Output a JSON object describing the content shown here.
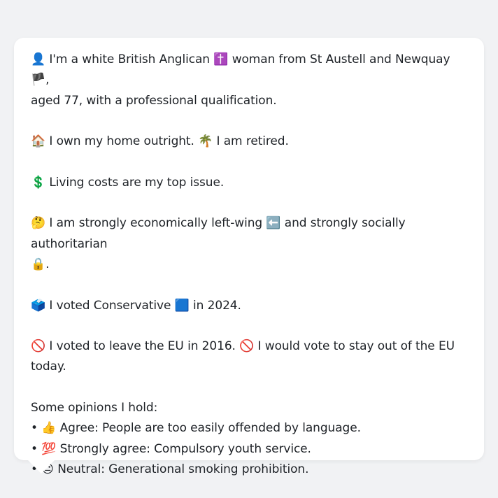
{
  "persona": {
    "intro_icon": "👤",
    "intro_a": "I'm a white British Anglican",
    "intro_cross": "✝️",
    "intro_b": "woman from St Austell and Newquay",
    "intro_flag": "🏴",
    "intro_c": ",",
    "intro_d": "aged 77, with a professional qualification.",
    "home_icon": "🏠",
    "home_text": "I own my home outright.",
    "retired_icon": "🌴",
    "retired_text": "I am retired.",
    "issue_icon": "💲",
    "issue_text": "Living costs are my top issue.",
    "ideology_icon": "🤔",
    "ideology_a": "I am strongly economically left-wing",
    "ideology_left_icon": "⬅️",
    "ideology_b": "and strongly socially authoritarian",
    "ideology_lock_icon": "🔒",
    "ideology_end": ".",
    "vote_icon": "🗳️",
    "vote_a": "I voted Conservative",
    "vote_party_icon": "🟦",
    "vote_b": "in 2024.",
    "eu_icon": "🚫",
    "eu_a": "I voted to leave the EU in 2016.",
    "eu_icon2": "🚫",
    "eu_b": "I would vote to stay out of the EU",
    "eu_c": "today.",
    "opinions_heading": "Some opinions I hold:",
    "opinions": [
      {
        "bullet": "•",
        "icon": "👍",
        "text": "Agree: People are too easily offended by language."
      },
      {
        "bullet": "•",
        "icon": "💯",
        "text": "Strongly agree: Compulsory youth service."
      },
      {
        "bullet": "•",
        "icon": "😐",
        "text": "Neutral: Generational smoking prohibition."
      }
    ]
  },
  "colors": {
    "page_background": "#f1f2f4",
    "card_background": "#ffffff",
    "text": "#1e2227"
  }
}
